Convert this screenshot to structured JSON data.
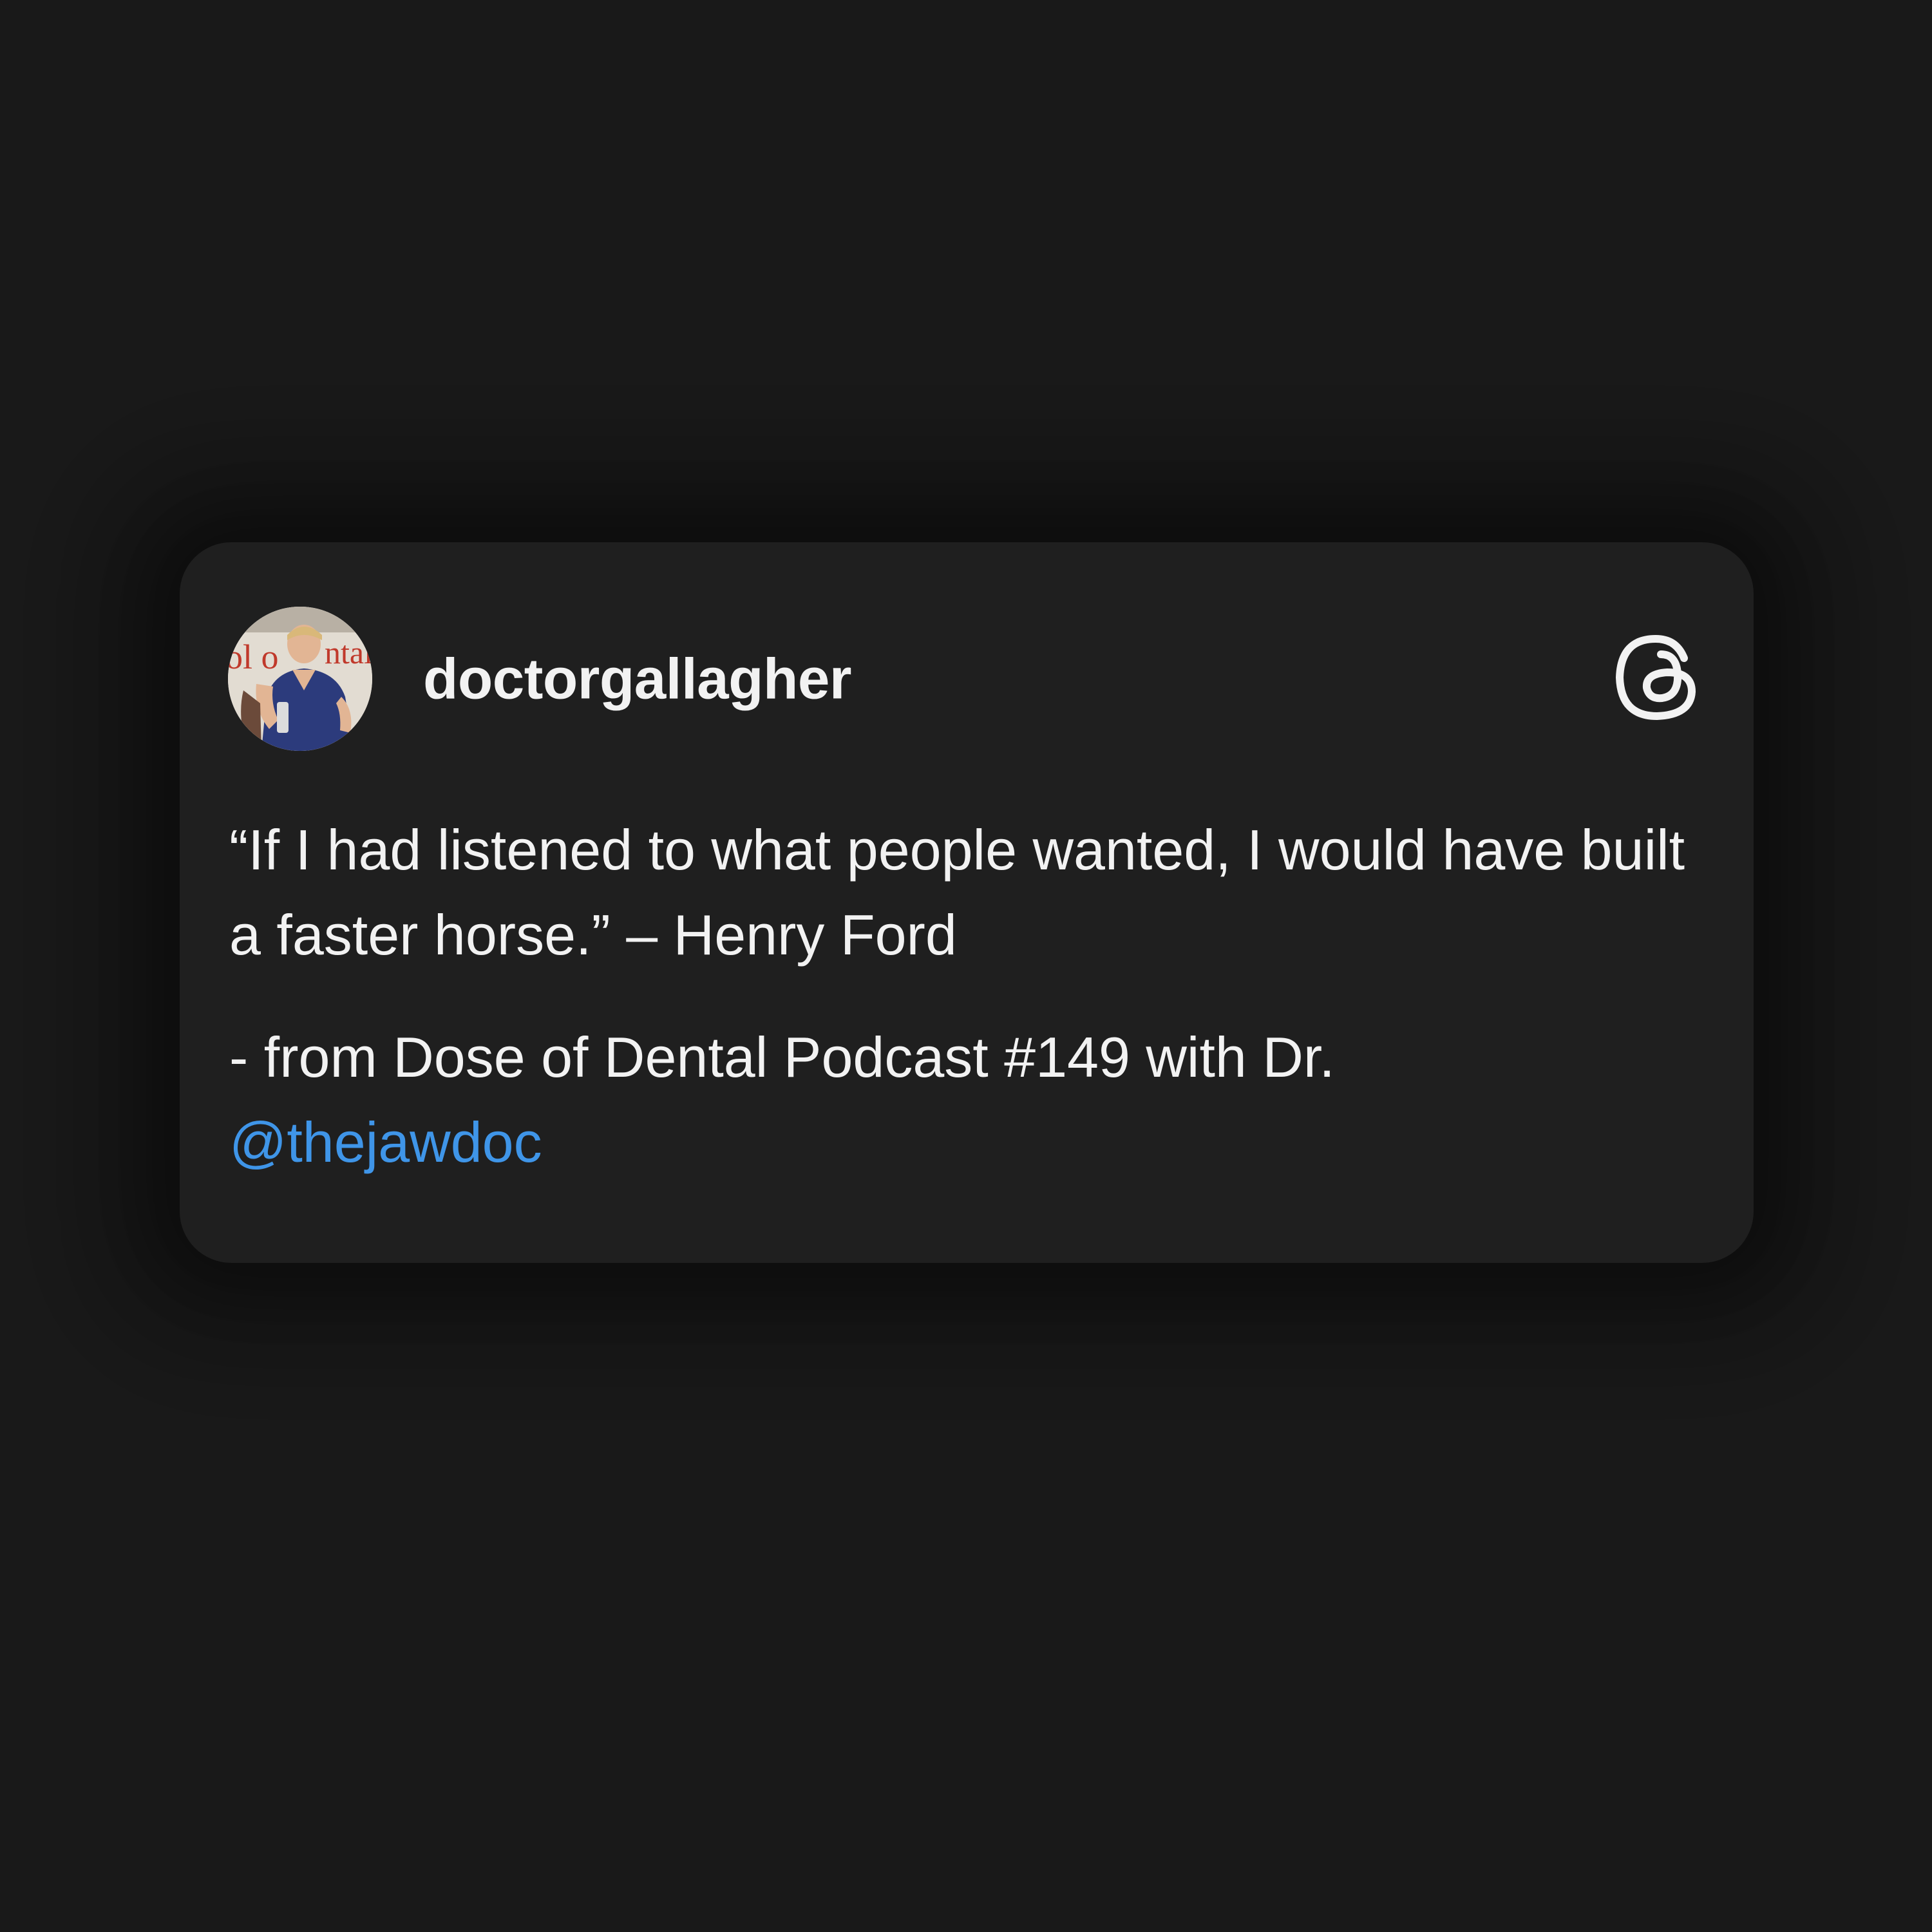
{
  "post": {
    "username": "doctorgallagher",
    "avatar_icon": "profile-photo-avatar",
    "brand_icon": "threads-logo-icon",
    "quote": "“If I had listened to what people wanted, I would have built a faster horse.” – Henry Ford",
    "source_text": "- from Dose of Dental Podcast #149 with Dr.",
    "mention": "@thejawdoc"
  },
  "colors": {
    "background": "#191919",
    "card": "#1f1f1f",
    "text": "#f2f2f2",
    "mention": "#3f95e8"
  }
}
